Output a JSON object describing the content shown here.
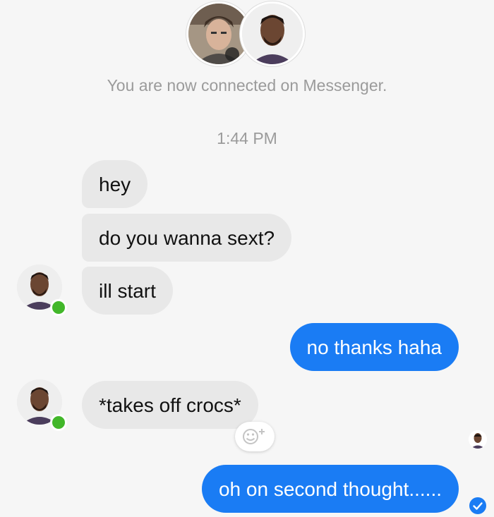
{
  "header": {
    "connected_text": "You are now connected on Messenger.",
    "timestamp": "1:44 PM"
  },
  "messages": [
    {
      "side": "incoming",
      "text": "hey"
    },
    {
      "side": "incoming",
      "text": "do you wanna sext?"
    },
    {
      "side": "incoming",
      "text": "ill start"
    },
    {
      "side": "outgoing",
      "text": "no thanks haha"
    },
    {
      "side": "incoming",
      "text": "*takes off crocs*"
    },
    {
      "side": "outgoing",
      "text": "oh on second thought......"
    }
  ],
  "icons": {
    "reaction": "smiley-plus-icon",
    "online": "online-status-dot",
    "sent": "check-circle-icon"
  },
  "colors": {
    "background": "#f6f6f6",
    "incoming_bubble": "#e8e8e8",
    "outgoing_bubble": "#1a7cf4",
    "online_dot": "#42b72a",
    "meta_text": "#9b9b9b"
  }
}
